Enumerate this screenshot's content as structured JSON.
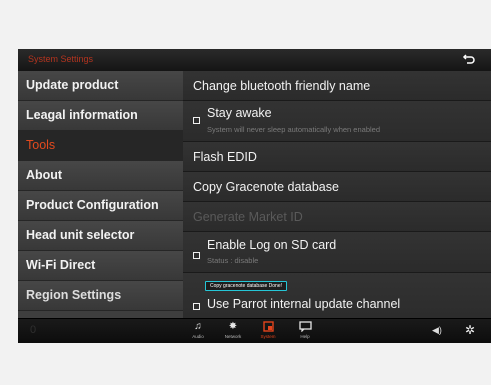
{
  "header": {
    "title": "System Settings",
    "back_icon": "back-arrow-icon"
  },
  "menu": {
    "items": [
      {
        "label": "Update product"
      },
      {
        "label": "Leagal information"
      },
      {
        "label": "Tools",
        "active": true
      },
      {
        "label": "About"
      },
      {
        "label": "Product Configuration"
      },
      {
        "label": "Head unit selector"
      },
      {
        "label": "Wi-Fi Direct"
      },
      {
        "label": "Region Settings"
      }
    ]
  },
  "content": {
    "rows": [
      {
        "label": "Change bluetooth friendly name"
      },
      {
        "label": "Stay awake",
        "subtitle": "System will never sleep automatically when enabled",
        "checkbox": true
      },
      {
        "label": "Flash EDID"
      },
      {
        "label": "Copy Gracenote database"
      },
      {
        "label": "Generate Market ID",
        "disabled": true
      },
      {
        "label": "Enable Log on SD card",
        "subtitle": "Status : disable",
        "checkbox": true
      },
      {
        "label": "Use Parrot internal update channel",
        "checkbox": true
      }
    ],
    "toast": "Copy gracenote database Done!"
  },
  "bottombar": {
    "faded_text": "0",
    "tabs": [
      {
        "label": "Audio",
        "icon": "music-note-icon"
      },
      {
        "label": "Network",
        "icon": "satellite-icon"
      },
      {
        "label": "System",
        "icon": "system-icon",
        "active": true
      },
      {
        "label": "Help",
        "icon": "help-icon"
      }
    ],
    "volume_icon": "volume-icon",
    "settings_icon": "settings-gear-icon"
  },
  "colors": {
    "accent": "#e4441c",
    "toast_border": "#26c6d6",
    "title": "#b3341f"
  }
}
